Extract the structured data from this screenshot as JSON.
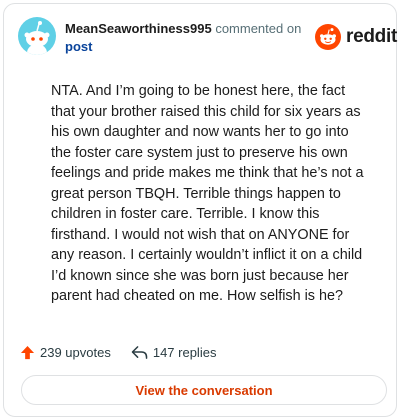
{
  "header": {
    "username": "MeanSeaworthiness995",
    "commented_on": "commented on",
    "post_link": "post",
    "logo_text": "reddit"
  },
  "comment": {
    "body": "NTA. And I’m going to be honest here, the fact that your brother raised this child for six years as his own daughter and now wants her to go into the foster care system just to preserve his own feelings and pride makes me think that he’s not a great person TBQH. Terrible things happen to children in foster care. Terrible. I know this firsthand. I would not wish that on ANYONE for any reason. I certainly wouldn’t inflict it on a child I’d known since she was born just because her parent had cheated on me. How selfish is he?"
  },
  "actions": {
    "upvotes": "239 upvotes",
    "replies": "147 replies",
    "view_button": "View the conversation"
  },
  "colors": {
    "accent": "#d93a00",
    "upvote": "#ff4500",
    "avatar_bg": "#5fd0e6",
    "link": "#0a449b"
  },
  "icons": {
    "avatar": "snoo-avatar",
    "logo": "reddit-snoo-icon",
    "upvote": "upvote-arrow-icon",
    "reply": "reply-arrow-icon"
  }
}
